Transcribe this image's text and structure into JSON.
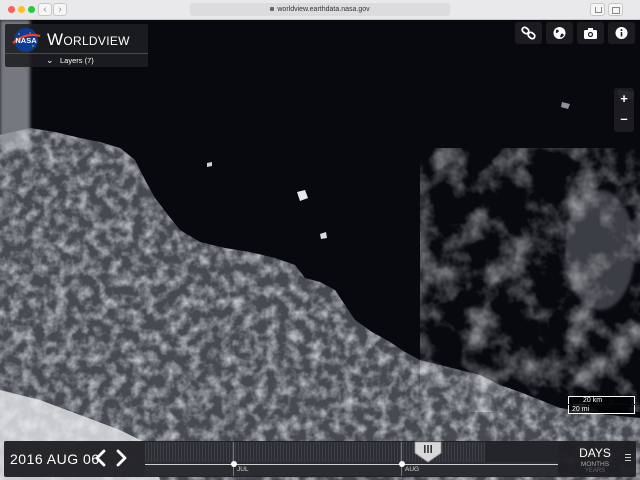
{
  "browser": {
    "url": "worldview.earthdata.nasa.gov"
  },
  "header": {
    "app_title": "Worldview",
    "logo_text": "NASA",
    "layers_label": "Layers (7)"
  },
  "toolbar": {
    "icons": [
      "link-icon",
      "globe-icon",
      "camera-icon",
      "info-icon"
    ]
  },
  "map_controls": {
    "zoom_in_label": "+",
    "zoom_out_label": "–"
  },
  "scale_bar": {
    "km_label": "20 km",
    "mi_label": "20 mi"
  },
  "timeline": {
    "current_date": "2016 AUG 06",
    "prev_icon": "chevron-left-icon",
    "next_icon": "chevron-right-icon",
    "month_labels": [
      "JUL",
      "AUG"
    ],
    "zoom_level": "DAYS",
    "zoom_option_months": "MONTHS",
    "zoom_option_years": "YEARS"
  },
  "colors": {
    "ocean": "#07090f",
    "ice": "#e6e9ee",
    "panel": "#1e1e22"
  }
}
